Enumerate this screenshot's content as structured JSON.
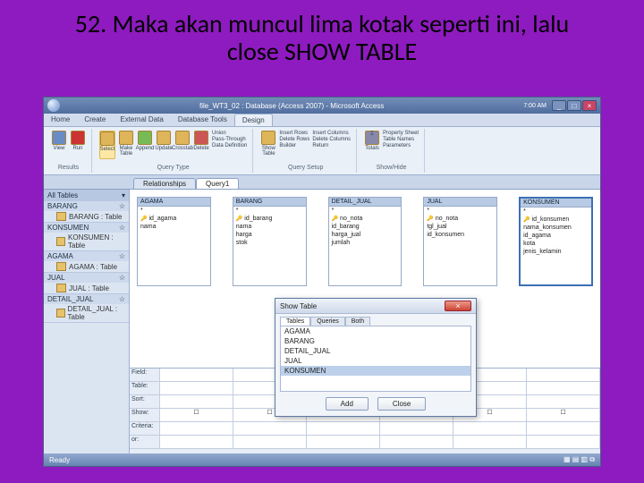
{
  "slide": {
    "title": "52. Maka akan muncul lima kotak seperti ini, lalu close SHOW TABLE"
  },
  "titlebar": {
    "doc": "file_WT3_02 : Database (Access 2007) - Microsoft Access",
    "time": "7:00 AM"
  },
  "tabs": {
    "home": "Home",
    "create": "Create",
    "external": "External Data",
    "dbtools": "Database Tools",
    "design": "Design"
  },
  "ribbon": {
    "view": "View",
    "run": "Run",
    "select": "Select",
    "make": "Make Table",
    "append": "Append",
    "update": "Update",
    "crosstab": "Crosstab",
    "delete": "Delete",
    "union": "Union",
    "passthrough": "Pass-Through",
    "datadef": "Data Definition",
    "showtable": "Show Table",
    "insertrows": "Insert Rows",
    "deleterows": "Delete Rows",
    "builder": "Builder",
    "insertcols": "Insert Columns",
    "deletecols": "Delete Columns",
    "return": "Return",
    "totals": "Totals",
    "propsheet": "Property Sheet",
    "tablenames": "Table Names",
    "params": "Parameters",
    "g1": "Results",
    "g2": "Query Type",
    "g3": "Query Setup",
    "g4": "Show/Hide"
  },
  "doctabs": {
    "rel": "Relationships",
    "q1": "Query1"
  },
  "nav": {
    "header": "All Tables",
    "g1": "BARANG",
    "g1i1": "BARANG : Table",
    "g2": "KONSUMEN",
    "g2i1": "KONSUMEN : Table",
    "g3": "AGAMA",
    "g3i1": "AGAMA : Table",
    "g4": "JUAL",
    "g4i1": "JUAL : Table",
    "g5": "DETAIL_JUAL",
    "g5i1": "DETAIL_JUAL : Table"
  },
  "boxes": {
    "agama": {
      "title": "AGAMA",
      "f1": "id_agama",
      "f2": "nama"
    },
    "barang": {
      "title": "BARANG",
      "f1": "id_barang",
      "f2": "nama",
      "f3": "harga",
      "f4": "stok"
    },
    "detail": {
      "title": "DETAIL_JUAL",
      "f1": "no_nota",
      "f2": "id_barang",
      "f3": "harga_jual",
      "f4": "jumlah"
    },
    "jual": {
      "title": "JUAL",
      "f1": "no_nota",
      "f2": "tgl_jual",
      "f3": "id_konsumen"
    },
    "konsumen": {
      "title": "KONSUMEN",
      "f1": "id_konsumen",
      "f2": "nama_konsumen",
      "f3": "id_agama",
      "f4": "kota",
      "f5": "jenis_kelamin"
    }
  },
  "grid": {
    "r1": "Field:",
    "r2": "Table:",
    "r3": "Sort:",
    "r4": "Show:",
    "r5": "Criteria:",
    "r6": "or:"
  },
  "dialog": {
    "title": "Show Table",
    "tab1": "Tables",
    "tab2": "Queries",
    "tab3": "Both",
    "i1": "AGAMA",
    "i2": "BARANG",
    "i3": "DETAIL_JUAL",
    "i4": "JUAL",
    "i5": "KONSUMEN",
    "add": "Add",
    "close": "Close"
  },
  "status": {
    "ready": "Ready"
  }
}
